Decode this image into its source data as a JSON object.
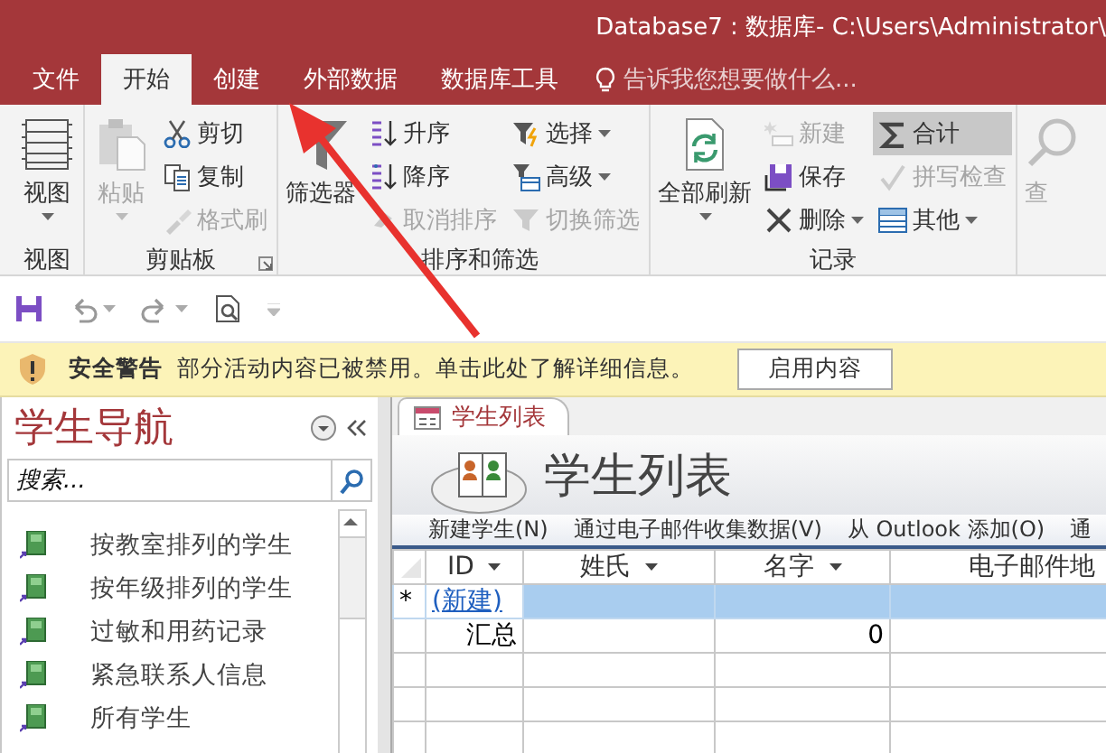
{
  "window": {
    "title": "Database7 : 数据库- C:\\Users\\Administrator\\"
  },
  "ribbon_tabs": [
    {
      "label": "文件",
      "selected": false
    },
    {
      "label": "开始",
      "selected": true
    },
    {
      "label": "创建",
      "selected": false
    },
    {
      "label": "外部数据",
      "selected": false
    },
    {
      "label": "数据库工具",
      "selected": false
    }
  ],
  "tell_me": {
    "placeholder": "告诉我您想要做什么..."
  },
  "ribbon_groups": [
    {
      "label": "视图",
      "launcher": false,
      "commands": [
        {
          "kind": "large",
          "label": "视图",
          "dropdown": true,
          "disabled": false,
          "on": false
        }
      ]
    },
    {
      "label": "剪贴板",
      "launcher": true,
      "commands": [
        {
          "kind": "large",
          "label": "粘贴",
          "dropdown": true,
          "disabled": true,
          "on": false
        },
        {
          "kind": "small",
          "label": "剪切",
          "dropdown": false,
          "disabled": false,
          "on": false
        },
        {
          "kind": "small",
          "label": "复制",
          "dropdown": false,
          "disabled": false,
          "on": false
        },
        {
          "kind": "small",
          "label": "格式刷",
          "dropdown": false,
          "disabled": true,
          "on": false
        }
      ]
    },
    {
      "label": "排序和筛选",
      "launcher": false,
      "commands": [
        {
          "kind": "large",
          "label": "筛选器",
          "dropdown": false,
          "disabled": false,
          "on": false
        },
        {
          "kind": "small",
          "label": "升序",
          "dropdown": false,
          "disabled": false,
          "on": false
        },
        {
          "kind": "small",
          "label": "降序",
          "dropdown": false,
          "disabled": false,
          "on": false
        },
        {
          "kind": "small",
          "label": "取消排序",
          "dropdown": false,
          "disabled": true,
          "on": false
        },
        {
          "kind": "small",
          "label": "选择",
          "dropdown": true,
          "disabled": false,
          "on": false
        },
        {
          "kind": "small",
          "label": "高级",
          "dropdown": true,
          "disabled": false,
          "on": false
        },
        {
          "kind": "small",
          "label": "切换筛选",
          "dropdown": false,
          "disabled": true,
          "on": false
        }
      ]
    },
    {
      "label": "记录",
      "launcher": false,
      "commands": [
        {
          "kind": "large",
          "label": "全部刷新",
          "dropdown": true,
          "disabled": false,
          "on": false
        },
        {
          "kind": "small",
          "label": "新建",
          "dropdown": false,
          "disabled": true,
          "on": false
        },
        {
          "kind": "small",
          "label": "保存",
          "dropdown": false,
          "disabled": false,
          "on": false
        },
        {
          "kind": "small",
          "label": "删除",
          "dropdown": true,
          "disabled": false,
          "on": false
        },
        {
          "kind": "small",
          "label": "合计",
          "dropdown": false,
          "disabled": false,
          "on": true
        },
        {
          "kind": "small",
          "label": "拼写检查",
          "dropdown": false,
          "disabled": true,
          "on": false
        },
        {
          "kind": "small",
          "label": "其他",
          "dropdown": true,
          "disabled": false,
          "on": false
        }
      ]
    },
    {
      "launcher": false,
      "commands": [
        {
          "kind": "large",
          "label": "查",
          "dropdown": false,
          "disabled": true,
          "on": false
        }
      ]
    }
  ],
  "security_bar": {
    "title": "安全警告",
    "message": "部分活动内容已被禁用。单击此处了解详细信息。",
    "button": "启用内容"
  },
  "navigation": {
    "title": "学生导航",
    "search": {
      "placeholder": "搜索..."
    },
    "items": [
      {
        "label": "按教室排列的学生"
      },
      {
        "label": "按年级排列的学生"
      },
      {
        "label": "过敏和用药记录"
      },
      {
        "label": "紧急联系人信息"
      },
      {
        "label": "所有学生"
      }
    ]
  },
  "document_tabs": [
    {
      "label": "学生列表",
      "selected": true
    }
  ],
  "form": {
    "title": "学生列表",
    "actions": [
      "新建学生(N)",
      "通过电子邮件收集数据(V)",
      "从 Outlook 添加(O)",
      "通"
    ],
    "table": {
      "columns": [
        {
          "label": "ID",
          "filter": true,
          "total": "汇总"
        },
        {
          "label": "姓氏",
          "filter": true
        },
        {
          "label": "名字",
          "filter": true,
          "total": "0"
        },
        {
          "label": "电子邮件地"
        }
      ],
      "new_row": {
        "marker": "*",
        "label": "(新建)"
      }
    }
  }
}
